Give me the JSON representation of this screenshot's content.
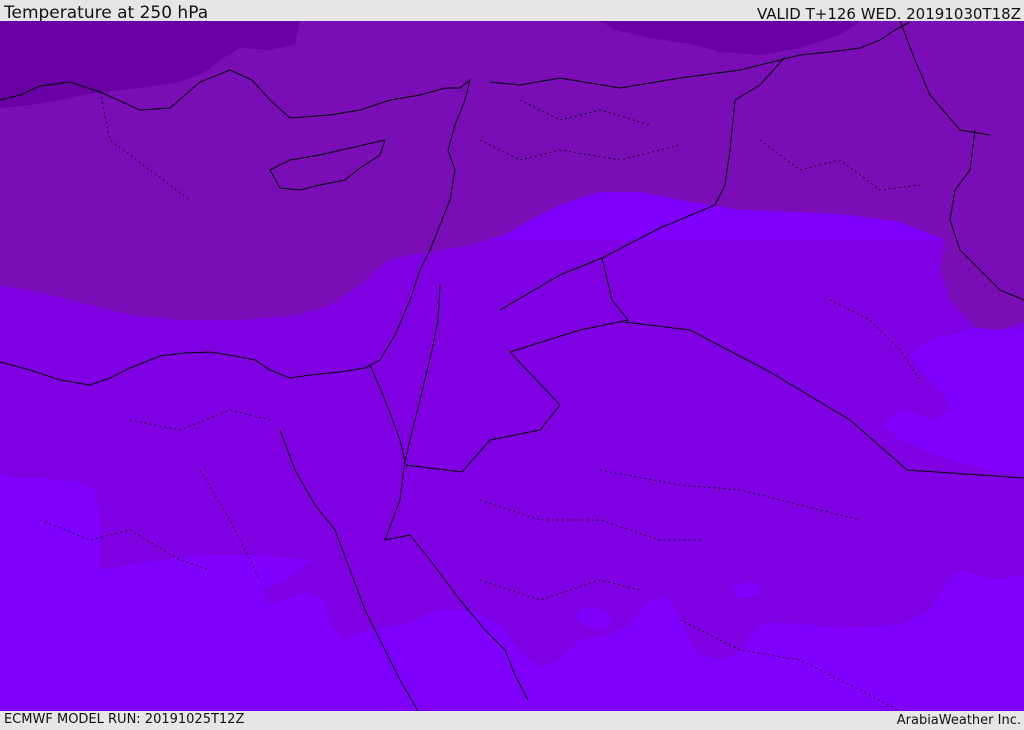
{
  "header": {
    "title": "Temperature at 250 hPa",
    "valid": "VALID T+126 WED. 20191030T18Z"
  },
  "footer": {
    "model_run": "ECMWF MODEL RUN: 20191025T12Z",
    "credit": "ArabiaWeather Inc."
  },
  "map": {
    "colors": {
      "coldest": "#6800a6",
      "cold": "#7a0eb6",
      "mid": "#7f00e2",
      "warm": "#7f00ff",
      "coastline": "#000000"
    }
  }
}
